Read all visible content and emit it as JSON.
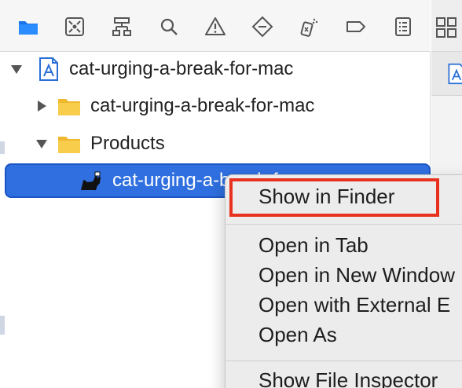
{
  "toolbar": {
    "icons": [
      "folder-icon",
      "source-control-icon",
      "symbol-hierarchy-icon",
      "search-icon",
      "warning-icon",
      "test-diamond-icon",
      "debug-spray-icon",
      "breakpoint-tag-icon",
      "report-list-icon"
    ]
  },
  "tree": {
    "project": {
      "label": "cat-urging-a-break-for-mac"
    },
    "folder": {
      "label": "cat-urging-a-break-for-mac"
    },
    "products": {
      "label": "Products"
    },
    "product_app": {
      "label": "cat-urging-a-break-for"
    }
  },
  "context_menu": {
    "show_in_finder": "Show in Finder",
    "open_in_tab": "Open in Tab",
    "open_in_new_window": "Open in New Window",
    "open_with_external": "Open with External E",
    "open_as": "Open As",
    "show_file_inspector": "Show File Inspector"
  },
  "colors": {
    "accent": "#2f6fe0",
    "highlight": "#e8321f",
    "folder": "#f5c842"
  }
}
